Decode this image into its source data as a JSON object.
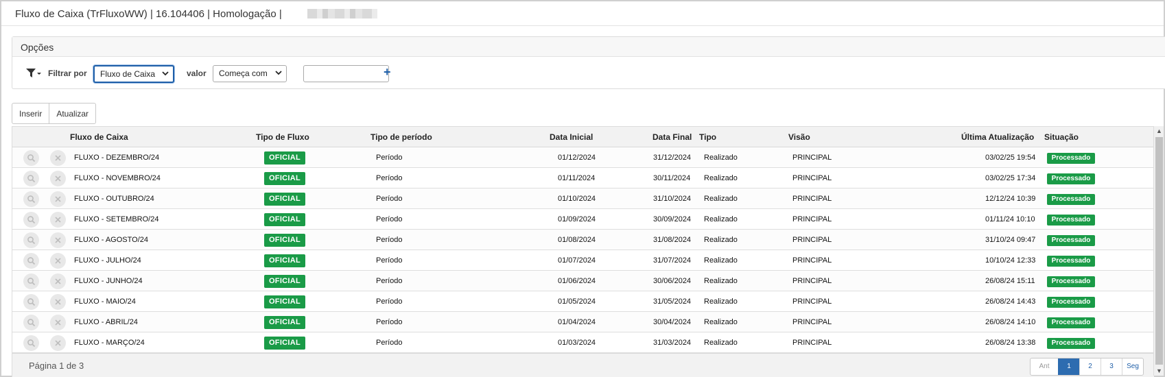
{
  "window": {
    "title": "Fluxo de Caixa (TrFluxoWW) | 16.104406 | Homologação |"
  },
  "options": {
    "section_title": "Opções",
    "filter_icon": "filter-icon",
    "filter_by_label": "Filtrar por",
    "filter_by_value": "Fluxo de Caixa",
    "value_label": "valor",
    "operator_value": "Começa com",
    "search_value": "",
    "add_filter_icon": "plus-icon"
  },
  "toolbar": {
    "insert_label": "Inserir",
    "refresh_label": "Atualizar"
  },
  "grid": {
    "columns": [
      "Fluxo de Caixa",
      "Tipo de Fluxo",
      "Tipo de período",
      "Data Inicial",
      "Data Final",
      "Tipo",
      "Visão",
      "Última Atualização",
      "Situação"
    ],
    "rows": [
      {
        "name": "FLUXO - DEZEMBRO/24",
        "flow_type": "OFICIAL",
        "period_type": "Período",
        "start": "01/12/2024",
        "end": "31/12/2024",
        "type": "Realizado",
        "view": "PRINCIPAL",
        "updated": "03/02/25 19:54",
        "status": "Processado"
      },
      {
        "name": "FLUXO - NOVEMBRO/24",
        "flow_type": "OFICIAL",
        "period_type": "Período",
        "start": "01/11/2024",
        "end": "30/11/2024",
        "type": "Realizado",
        "view": "PRINCIPAL",
        "updated": "03/02/25 17:34",
        "status": "Processado"
      },
      {
        "name": "FLUXO - OUTUBRO/24",
        "flow_type": "OFICIAL",
        "period_type": "Período",
        "start": "01/10/2024",
        "end": "31/10/2024",
        "type": "Realizado",
        "view": "PRINCIPAL",
        "updated": "12/12/24 10:39",
        "status": "Processado"
      },
      {
        "name": "FLUXO - SETEMBRO/24",
        "flow_type": "OFICIAL",
        "period_type": "Período",
        "start": "01/09/2024",
        "end": "30/09/2024",
        "type": "Realizado",
        "view": "PRINCIPAL",
        "updated": "01/11/24 10:10",
        "status": "Processado"
      },
      {
        "name": "FLUXO - AGOSTO/24",
        "flow_type": "OFICIAL",
        "period_type": "Período",
        "start": "01/08/2024",
        "end": "31/08/2024",
        "type": "Realizado",
        "view": "PRINCIPAL",
        "updated": "31/10/24 09:47",
        "status": "Processado"
      },
      {
        "name": "FLUXO - JULHO/24",
        "flow_type": "OFICIAL",
        "period_type": "Período",
        "start": "01/07/2024",
        "end": "31/07/2024",
        "type": "Realizado",
        "view": "PRINCIPAL",
        "updated": "10/10/24 12:33",
        "status": "Processado"
      },
      {
        "name": "FLUXO - JUNHO/24",
        "flow_type": "OFICIAL",
        "period_type": "Período",
        "start": "01/06/2024",
        "end": "30/06/2024",
        "type": "Realizado",
        "view": "PRINCIPAL",
        "updated": "26/08/24 15:11",
        "status": "Processado"
      },
      {
        "name": "FLUXO - MAIO/24",
        "flow_type": "OFICIAL",
        "period_type": "Período",
        "start": "01/05/2024",
        "end": "31/05/2024",
        "type": "Realizado",
        "view": "PRINCIPAL",
        "updated": "26/08/24 14:43",
        "status": "Processado"
      },
      {
        "name": "FLUXO - ABRIL/24",
        "flow_type": "OFICIAL",
        "period_type": "Período",
        "start": "01/04/2024",
        "end": "30/04/2024",
        "type": "Realizado",
        "view": "PRINCIPAL",
        "updated": "26/08/24 14:10",
        "status": "Processado"
      },
      {
        "name": "FLUXO - MARÇO/24",
        "flow_type": "OFICIAL",
        "period_type": "Período",
        "start": "01/03/2024",
        "end": "31/03/2024",
        "type": "Realizado",
        "view": "PRINCIPAL",
        "updated": "26/08/24 13:38",
        "status": "Processado"
      }
    ],
    "row_actions": [
      "search-icon",
      "close-icon"
    ]
  },
  "pagination": {
    "info": "Página 1 de 3",
    "prev_label": "Ant",
    "pages": [
      "1",
      "2",
      "3"
    ],
    "current_page": "1",
    "next_label": "Seg"
  },
  "colors": {
    "accent": "#2d6cb0",
    "badge_green": "#1a9b47"
  }
}
